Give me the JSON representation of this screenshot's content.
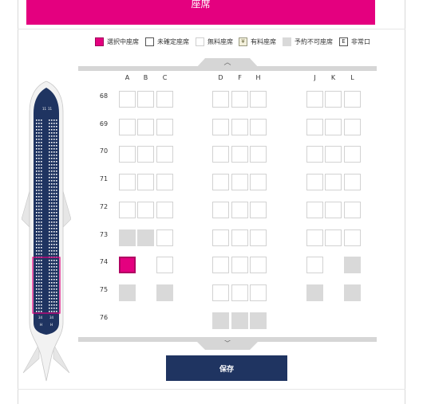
{
  "banner": {
    "title": "座席"
  },
  "legend": {
    "items": [
      {
        "key": "selected",
        "label": "選択中座席"
      },
      {
        "key": "undecided",
        "label": "未確定座席"
      },
      {
        "key": "free",
        "label": "無料座席"
      },
      {
        "key": "paid",
        "label": "有料座席",
        "icon": "seat-fee-icon"
      },
      {
        "key": "unavailable",
        "label": "予約不可座席"
      },
      {
        "key": "exit",
        "label": "非常口",
        "icon_text": "E"
      }
    ]
  },
  "colors": {
    "brand_pink": "#e4007f",
    "navy": "#1f3461",
    "unavailable": "#d9d9d9",
    "fuselage": "#1f3461"
  },
  "seat_map": {
    "columns": [
      "A",
      "B",
      "C",
      "D",
      "F",
      "H",
      "J",
      "K",
      "L"
    ],
    "rows": [
      {
        "number": "68",
        "seats": [
          "free",
          "free",
          "free",
          "free",
          "free",
          "free",
          "free",
          "free",
          "free"
        ]
      },
      {
        "number": "69",
        "seats": [
          "free",
          "free",
          "free",
          "free",
          "free",
          "free",
          "free",
          "free",
          "free"
        ]
      },
      {
        "number": "70",
        "seats": [
          "free",
          "free",
          "free",
          "free",
          "free",
          "free",
          "free",
          "free",
          "free"
        ]
      },
      {
        "number": "71",
        "seats": [
          "free",
          "free",
          "free",
          "free",
          "free",
          "free",
          "free",
          "free",
          "free"
        ]
      },
      {
        "number": "72",
        "seats": [
          "free",
          "free",
          "free",
          "free",
          "free",
          "free",
          "free",
          "free",
          "free"
        ]
      },
      {
        "number": "73",
        "seats": [
          "unavailable",
          "unavailable",
          "free",
          "free",
          "free",
          "free",
          "free",
          "free",
          "free"
        ]
      },
      {
        "number": "74",
        "seats": [
          "selected",
          null,
          "free",
          "free",
          "free",
          "free",
          "free",
          null,
          "unavailable"
        ]
      },
      {
        "number": "75",
        "seats": [
          "unavailable",
          null,
          "unavailable",
          "free",
          "free",
          "free",
          "unavailable",
          null,
          "unavailable"
        ]
      },
      {
        "number": "76",
        "seats": [
          null,
          null,
          null,
          "unavailable",
          "unavailable",
          "unavailable",
          null,
          null,
          null
        ]
      }
    ]
  },
  "nav": {
    "scroll_up_icon": "chevron-up-icon",
    "scroll_down_icon": "chevron-down-icon"
  },
  "actions": {
    "save_label": "保存"
  },
  "plane_overview": {
    "cabin_labels_top": [
      "11",
      "11"
    ],
    "cabin_labels_bottom": [
      "34",
      "34",
      "H",
      "H"
    ]
  }
}
